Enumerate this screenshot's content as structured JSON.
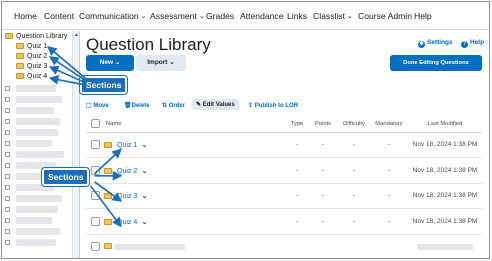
{
  "nav": {
    "items": [
      {
        "label": "Home",
        "dropdown": false
      },
      {
        "label": "Content",
        "dropdown": false
      },
      {
        "label": "Communication",
        "dropdown": true
      },
      {
        "label": "Assessment",
        "dropdown": true
      },
      {
        "label": "Grades",
        "dropdown": false
      },
      {
        "label": "Attendance",
        "dropdown": false
      },
      {
        "label": "Links",
        "dropdown": false
      },
      {
        "label": "Classlist",
        "dropdown": true
      },
      {
        "label": "Course Admin",
        "dropdown": false
      },
      {
        "label": "Help",
        "dropdown": false
      }
    ]
  },
  "tree": {
    "root_label": "Question Library",
    "items": [
      "Quiz 1",
      "Quiz 2",
      "Quiz 3",
      "Quiz 4"
    ]
  },
  "main": {
    "title": "Question Library",
    "settings_label": "Settings",
    "help_label": "Help",
    "new_label": "New",
    "import_label": "Import",
    "done_label": "Done Editing Questions",
    "toolbar": {
      "move": "Move",
      "delete": "Delete",
      "order": "Order",
      "edit_values": "Edit Values",
      "publish": "Publish to LOR"
    }
  },
  "table": {
    "headers": {
      "name": "Name",
      "type": "Type",
      "points": "Points",
      "difficulty": "Difficulty",
      "mandatory": "Mandatory",
      "last_modified": "Last Modified"
    },
    "rows": [
      {
        "name": "Quiz 1",
        "type": "-",
        "points": "-",
        "difficulty": "-",
        "mandatory": "-",
        "modified": "Nov 18, 2024 1:38 PM"
      },
      {
        "name": "Quiz 2",
        "type": "-",
        "points": "-",
        "difficulty": "-",
        "mandatory": "-",
        "modified": "Nov 18, 2024 1:38 PM"
      },
      {
        "name": "Quiz 3",
        "type": "-",
        "points": "-",
        "difficulty": "-",
        "mandatory": "-",
        "modified": "Nov 18, 2024 1:38 PM"
      },
      {
        "name": "Quiz 4",
        "type": "-",
        "points": "-",
        "difficulty": "-",
        "mandatory": "-",
        "modified": "Nov 18, 2024 1:38 PM"
      }
    ]
  },
  "callouts": {
    "top": "Sections",
    "bottom": "Sections"
  },
  "colors": {
    "accent": "#006fbf",
    "callout": "#1a6fb8",
    "folder": "#f2c45a"
  }
}
